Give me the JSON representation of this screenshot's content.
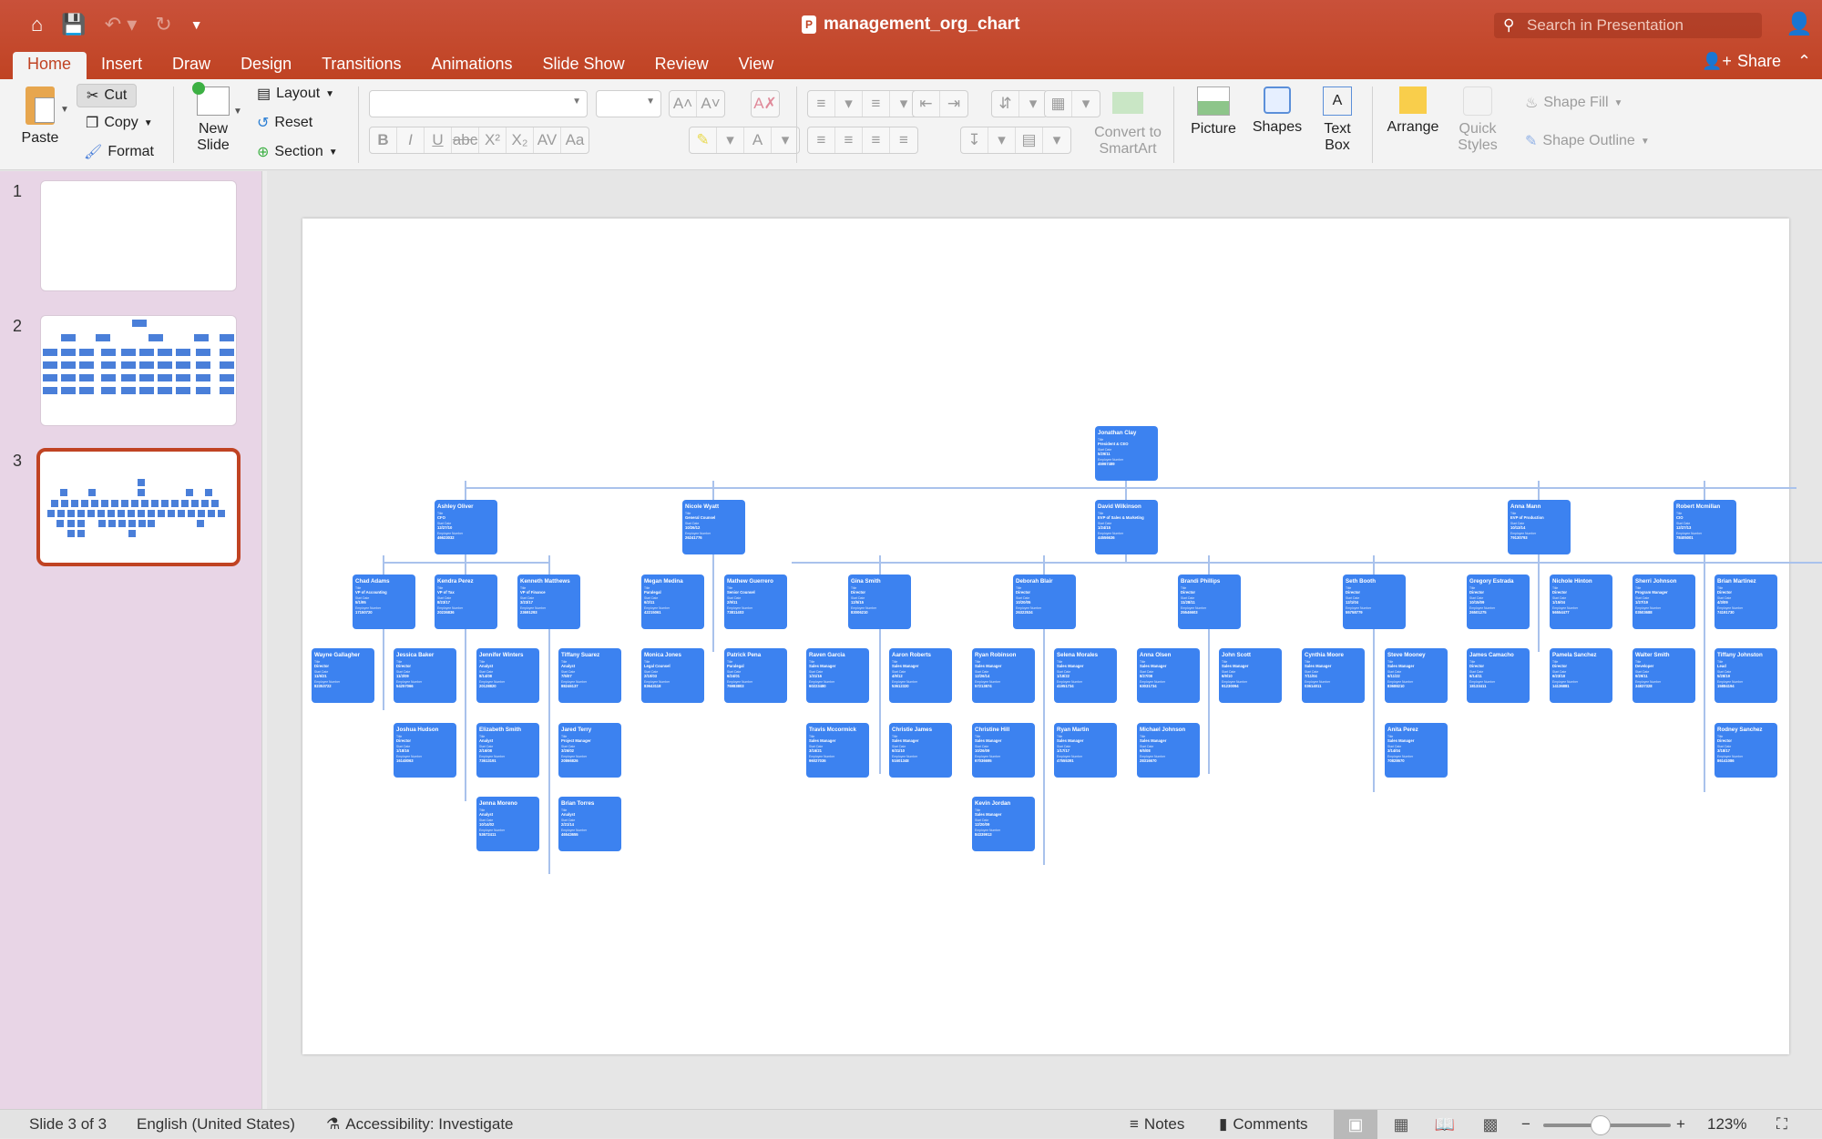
{
  "app": {
    "document_title": "management_org_chart",
    "search_placeholder": "Search in Presentation",
    "share_label": "Share"
  },
  "tabs": [
    {
      "label": "Home",
      "active": true
    },
    {
      "label": "Insert"
    },
    {
      "label": "Draw"
    },
    {
      "label": "Design"
    },
    {
      "label": "Transitions"
    },
    {
      "label": "Animations"
    },
    {
      "label": "Slide Show"
    },
    {
      "label": "Review"
    },
    {
      "label": "View"
    }
  ],
  "ribbon": {
    "paste": "Paste",
    "cut": "Cut",
    "copy": "Copy",
    "format": "Format",
    "new_slide": "New Slide",
    "layout": "Layout",
    "reset": "Reset",
    "section": "Section",
    "font_name": "",
    "font_size": "",
    "convert_smartart": "Convert to SmartArt",
    "picture": "Picture",
    "shapes": "Shapes",
    "text_box": "Text Box",
    "arrange": "Arrange",
    "quick_styles": "Quick Styles",
    "shape_fill": "Shape Fill",
    "shape_outline": "Shape Outline"
  },
  "slides_panel": {
    "slides": [
      {
        "number": "1"
      },
      {
        "number": "2"
      },
      {
        "number": "3",
        "selected": true
      }
    ]
  },
  "org_chart": {
    "field_labels": {
      "title": "Title",
      "start": "Start Date",
      "emp": "Employee Number"
    },
    "people": [
      {
        "id": "jc",
        "name": "Jonathan Clay",
        "title": "President & CEO",
        "start": "5/29/11",
        "emp": "45967489"
      },
      {
        "id": "ao",
        "name": "Ashley Oliver",
        "title": "CFO",
        "start": "12/27/10",
        "emp": "46623032"
      },
      {
        "id": "nw",
        "name": "Nicole Wyatt",
        "title": "General Counsel",
        "start": "10/26/12",
        "emp": "26241776"
      },
      {
        "id": "dw",
        "name": "David Wilkinson",
        "title": "EVP of Sales & Marketing",
        "start": "1/24/15",
        "emp": "44556636"
      },
      {
        "id": "am",
        "name": "Anna Mann",
        "title": "EVP of Production",
        "start": "10/13/14",
        "emp": "79130793"
      },
      {
        "id": "rm",
        "name": "Robert Mcmillan",
        "title": "CIO",
        "start": "12/27/13",
        "emp": "78405001"
      },
      {
        "id": "ca",
        "name": "Chad Adams",
        "title": "VP of Accounting",
        "start": "5/1/95",
        "emp": "17150720"
      },
      {
        "id": "kp",
        "name": "Kendra Perez",
        "title": "VP of Tax",
        "start": "8/23/17",
        "emp": "20236836"
      },
      {
        "id": "km",
        "name": "Kenneth Matthews",
        "title": "VP of Finance",
        "start": "3/23/17",
        "emp": "23691293"
      },
      {
        "id": "mm",
        "name": "Megan Medina",
        "title": "Paralegal",
        "start": "6/2/11",
        "emp": "42215061"
      },
      {
        "id": "mg",
        "name": "Mathew Guerrero",
        "title": "Senior Counsel",
        "start": "2/9/11",
        "emp": "73811403"
      },
      {
        "id": "gs",
        "name": "Gina Smith",
        "title": "Director",
        "start": "12/5/15",
        "emp": "83006210"
      },
      {
        "id": "db",
        "name": "Deborah Blair",
        "title": "Director",
        "start": "10/20/05",
        "emp": "26322534"
      },
      {
        "id": "bp",
        "name": "Brandi Phillips",
        "title": "Director",
        "start": "11/28/11",
        "emp": "25546603"
      },
      {
        "id": "sb",
        "name": "Seth Booth",
        "title": "Director",
        "start": "12/1/04",
        "emp": "55758779"
      },
      {
        "id": "ge",
        "name": "Gregory Estrada",
        "title": "Director",
        "start": "10/15/09",
        "emp": "26501275"
      },
      {
        "id": "nh",
        "name": "Nichole Hinton",
        "title": "Director",
        "start": "1/15/04",
        "emp": "56554477"
      },
      {
        "id": "sj",
        "name": "Sherri Johnson",
        "title": "Program Manager",
        "start": "1/27/19",
        "emp": "03503688"
      },
      {
        "id": "bm",
        "name": "Brian Martinez",
        "title": "Director",
        "start": "4/3/09",
        "emp": "74191730"
      },
      {
        "id": "wg",
        "name": "Wayne Gallagher",
        "title": "Director",
        "start": "11/6/21",
        "emp": "82353722"
      },
      {
        "id": "jb",
        "name": "Jessica Baker",
        "title": "Director",
        "start": "11/3/09",
        "emp": "54257066"
      },
      {
        "id": "jw",
        "name": "Jennifer Winters",
        "title": "Analyst",
        "start": "8/14/08",
        "emp": "20128820"
      },
      {
        "id": "ts",
        "name": "Tiffany Suarez",
        "title": "Analyst",
        "start": "7/5/07",
        "emp": "88246137"
      },
      {
        "id": "mj",
        "name": "Monica Jones",
        "title": "Legal Counsel",
        "start": "2/10/03",
        "emp": "83643118"
      },
      {
        "id": "pp",
        "name": "Patrick Pena",
        "title": "Paralegal",
        "start": "6/24/01",
        "emp": "76983803"
      },
      {
        "id": "rg",
        "name": "Raven Garcia",
        "title": "Sales Manager",
        "start": "1/31/16",
        "emp": "60223480"
      },
      {
        "id": "ar",
        "name": "Aaron Roberts",
        "title": "Sales Manager",
        "start": "4/9/12",
        "emp": "53612320"
      },
      {
        "id": "rr",
        "name": "Ryan Robinson",
        "title": "Sales Manager",
        "start": "12/26/14",
        "emp": "57213874"
      },
      {
        "id": "sm",
        "name": "Selena Morales",
        "title": "Sales Manager",
        "start": "1/18/22",
        "emp": "41951734"
      },
      {
        "id": "ao2",
        "name": "Anna Olsen",
        "title": "Sales Manager",
        "start": "8/27/08",
        "emp": "63031734"
      },
      {
        "id": "js",
        "name": "John Scott",
        "title": "Sales Manager",
        "start": "6/9/10",
        "emp": "91230094"
      },
      {
        "id": "cm",
        "name": "Cynthia Moore",
        "title": "Sales Manager",
        "start": "7/11/04",
        "emp": "03614011"
      },
      {
        "id": "smo",
        "name": "Steve Mooney",
        "title": "Sales Manager",
        "start": "6/11/22",
        "emp": "83688210"
      },
      {
        "id": "jca",
        "name": "James Camacho",
        "title": "Director",
        "start": "6/14/11",
        "emp": "18133411"
      },
      {
        "id": "ps",
        "name": "Pamela Sanchez",
        "title": "Director",
        "start": "6/23/18",
        "emp": "14136881"
      },
      {
        "id": "ws",
        "name": "Walter Smith",
        "title": "Developer",
        "start": "9/29/11",
        "emp": "34837328"
      },
      {
        "id": "tj",
        "name": "Tiffany Johnston",
        "title": "Lead",
        "start": "5/28/19",
        "emp": "15884194"
      },
      {
        "id": "jh",
        "name": "Joshua Hudson",
        "title": "Director",
        "start": "1/18/16",
        "emp": "16148063"
      },
      {
        "id": "es",
        "name": "Elizabeth Smith",
        "title": "Analyst",
        "start": "2/16/08",
        "emp": "73613191"
      },
      {
        "id": "jt",
        "name": "Jared Terry",
        "title": "Project Manager",
        "start": "3/26/02",
        "emp": "20866826"
      },
      {
        "id": "tm",
        "name": "Travis Mccormick",
        "title": "Sales Manager",
        "start": "3/16/21",
        "emp": "96027036"
      },
      {
        "id": "cj",
        "name": "Christie James",
        "title": "Sales Manager",
        "start": "6/31/10",
        "emp": "51601348"
      },
      {
        "id": "ch",
        "name": "Christine Hill",
        "title": "Sales Manager",
        "start": "10/26/09",
        "emp": "67036695"
      },
      {
        "id": "rma",
        "name": "Ryan Martin",
        "title": "Sales Manager",
        "start": "1/17/17",
        "emp": "47555391"
      },
      {
        "id": "mjo",
        "name": "Michael Johnson",
        "title": "Sales Manager",
        "start": "6/5/08",
        "emp": "28316670"
      },
      {
        "id": "ap",
        "name": "Anita Perez",
        "title": "Sales Manager",
        "start": "3/14/04",
        "emp": "70828670"
      },
      {
        "id": "rs",
        "name": "Rodney Sanchez",
        "title": "Director",
        "start": "3/18/17",
        "emp": "86141086"
      },
      {
        "id": "jm",
        "name": "Jenna Moreno",
        "title": "Analyst",
        "start": "10/14/02",
        "emp": "53672411"
      },
      {
        "id": "bt",
        "name": "Brian Torres",
        "title": "Analyst",
        "start": "2/21/14",
        "emp": "46543655"
      },
      {
        "id": "kj",
        "name": "Kevin Jordan",
        "title": "Sales Manager",
        "start": "12/20/09",
        "emp": "84339913"
      }
    ]
  },
  "status_bar": {
    "slide_indicator": "Slide 3 of 3",
    "language": "English (United States)",
    "accessibility": "Accessibility: Investigate",
    "notes": "Notes",
    "comments": "Comments",
    "zoom_level": "123%",
    "zoom_slider_fraction": 0.45
  }
}
